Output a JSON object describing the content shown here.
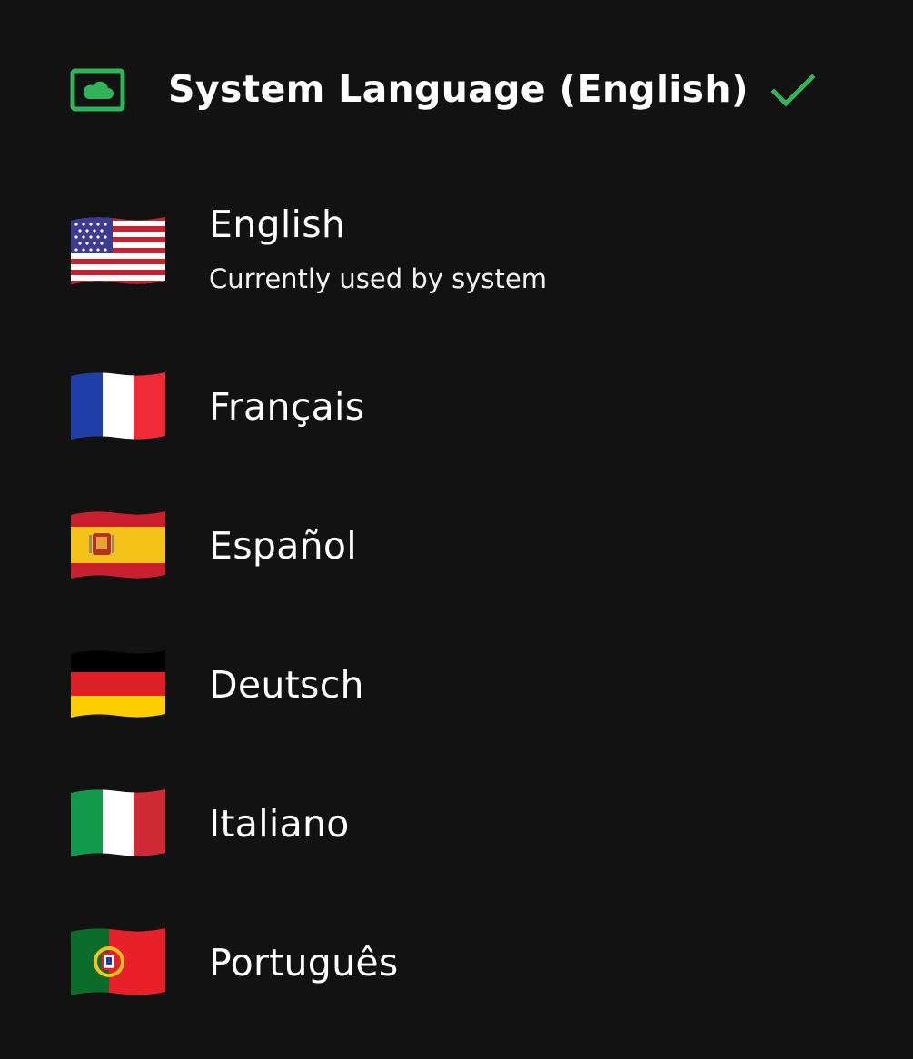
{
  "accent_color": "#2fb45a",
  "system_option": {
    "label": "System Language (English)",
    "icon": "cloud-screen-icon",
    "selected": true,
    "selected_icon": "check-icon"
  },
  "languages": [
    {
      "name": "English",
      "subtitle": "Currently used by system",
      "flag": "us-flag-icon"
    },
    {
      "name": "Français",
      "flag": "france-flag-icon"
    },
    {
      "name": "Español",
      "flag": "spain-flag-icon"
    },
    {
      "name": "Deutsch",
      "flag": "germany-flag-icon"
    },
    {
      "name": "Italiano",
      "flag": "italy-flag-icon"
    },
    {
      "name": "Português",
      "flag": "portugal-flag-icon"
    }
  ]
}
